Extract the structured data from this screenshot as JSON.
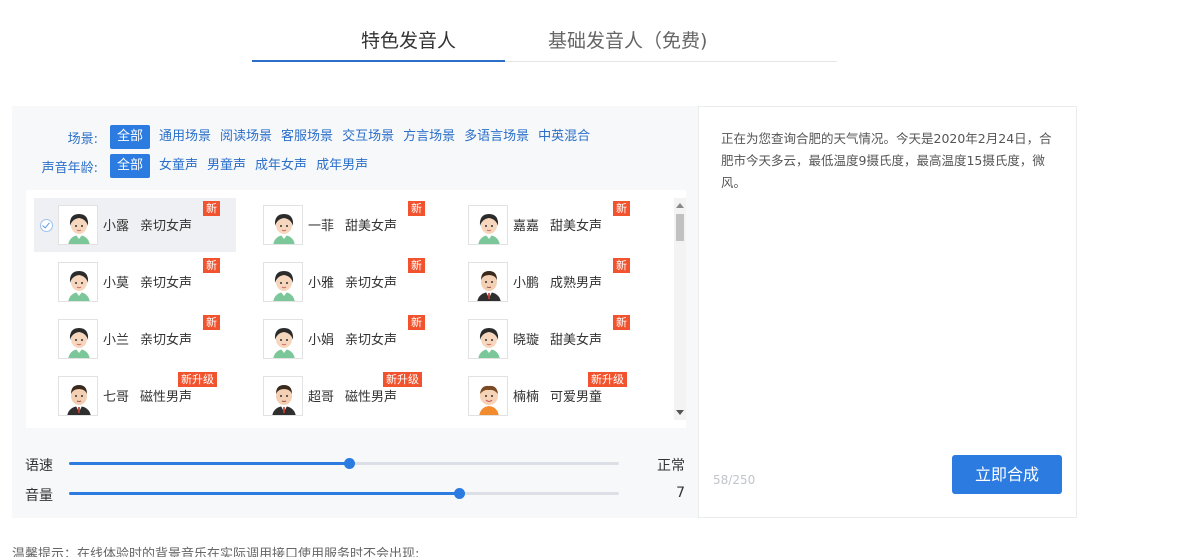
{
  "tabs": [
    {
      "label": "特色发音人",
      "active": true
    },
    {
      "label": "基础发音人（免费)",
      "active": false
    }
  ],
  "filters": {
    "scene": {
      "label": "场景:",
      "options": [
        "全部",
        "通用场景",
        "阅读场景",
        "客服场景",
        "交互场景",
        "方言场景",
        "多语言场景",
        "中英混合"
      ],
      "selected": "全部"
    },
    "age": {
      "label": "声音年龄:",
      "options": [
        "全部",
        "女童声",
        "男童声",
        "成年女声",
        "成年男声"
      ],
      "selected": "全部"
    }
  },
  "voices": [
    {
      "name": "小露",
      "style": "亲切女声",
      "badge": "新",
      "avatar": "female-avatar-icon",
      "selected": true
    },
    {
      "name": "一菲",
      "style": "甜美女声",
      "badge": "新",
      "avatar": "female-avatar-icon",
      "selected": false
    },
    {
      "name": "嘉嘉",
      "style": "甜美女声",
      "badge": "新",
      "avatar": "female-avatar-icon",
      "selected": false
    },
    {
      "name": "小莫",
      "style": "亲切女声",
      "badge": "新",
      "avatar": "female-avatar-icon",
      "selected": false
    },
    {
      "name": "小雅",
      "style": "亲切女声",
      "badge": "新",
      "avatar": "female-avatar-icon",
      "selected": false
    },
    {
      "name": "小鹏",
      "style": "成熟男声",
      "badge": "新",
      "avatar": "male-avatar-icon",
      "selected": false
    },
    {
      "name": "小兰",
      "style": "亲切女声",
      "badge": "新",
      "avatar": "female-avatar-icon",
      "selected": false
    },
    {
      "name": "小娟",
      "style": "亲切女声",
      "badge": "新",
      "avatar": "female-avatar-icon",
      "selected": false
    },
    {
      "name": "晓璇",
      "style": "甜美女声",
      "badge": "新",
      "avatar": "female-avatar-icon",
      "selected": false
    },
    {
      "name": "七哥",
      "style": "磁性男声",
      "badge": "新升级",
      "avatar": "male-avatar-icon",
      "selected": false
    },
    {
      "name": "超哥",
      "style": "磁性男声",
      "badge": "新升级",
      "avatar": "male-avatar-icon",
      "selected": false
    },
    {
      "name": "楠楠",
      "style": "可爱男童",
      "badge": "新升级",
      "avatar": "child-avatar-icon",
      "selected": false
    }
  ],
  "controls": {
    "speed": {
      "label": "语速",
      "value_text": "正常",
      "level": 0.509
    },
    "volume": {
      "label": "音量",
      "value_text": "7",
      "level": 0.709
    }
  },
  "editor": {
    "text": "正在为您查询合肥的天气情况。今天是2020年2月24日，合肥市今天多云，最低温度9摄氏度，最高温度15摄氏度，微风。",
    "char_count": "58/250"
  },
  "synthesize_label": "立即合成",
  "tip": "温馨提示：在线体验时的背景音乐在实际调用接口使用服务时不会出现;",
  "colors": {
    "primary": "#2b7be0",
    "badge": "#f0532d",
    "link": "#2b6fc9"
  }
}
